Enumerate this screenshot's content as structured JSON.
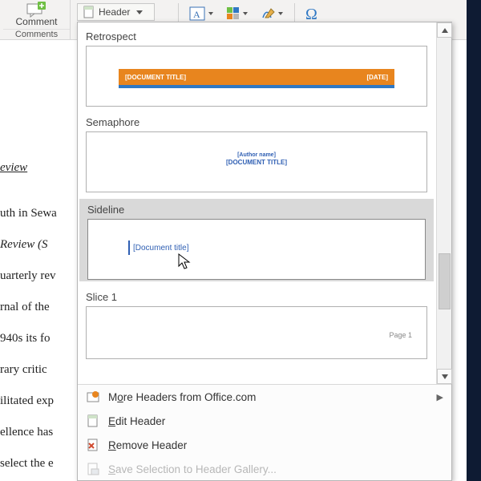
{
  "ribbon": {
    "comment_button": "Comment",
    "comment_group": "Comments",
    "header_button": "Header"
  },
  "gallery": {
    "styles": {
      "retrospect": {
        "name": "Retrospect",
        "left_text": "[DOCUMENT TITLE]",
        "right_text": "[DATE]"
      },
      "semaphore": {
        "name": "Semaphore",
        "line1": "[Author name]",
        "line2": "[DOCUMENT TITLE]"
      },
      "sideline": {
        "name": "Sideline",
        "text": "[Document title]"
      },
      "slice1": {
        "name": "Slice 1",
        "text": "Page 1"
      }
    }
  },
  "menu": {
    "more": {
      "pre": "M",
      "u": "o",
      "post": "re Headers from Office.com"
    },
    "edit": {
      "u": "E",
      "post": "dit Header"
    },
    "remove": {
      "u": "R",
      "post": "emove Header"
    },
    "save": {
      "u": "S",
      "post": "ave Selection to Header Gallery..."
    }
  },
  "doc": {
    "title": "eview",
    "l1": "uth in Sewa",
    "l2": "Review (S",
    "l3": "uarterly rev",
    "l4": "rnal of the",
    "l5": "940s its fo",
    "l6": "rary critic",
    "l7": "ilitated exp",
    "l8": "ellence has",
    "l9": "select the e"
  }
}
